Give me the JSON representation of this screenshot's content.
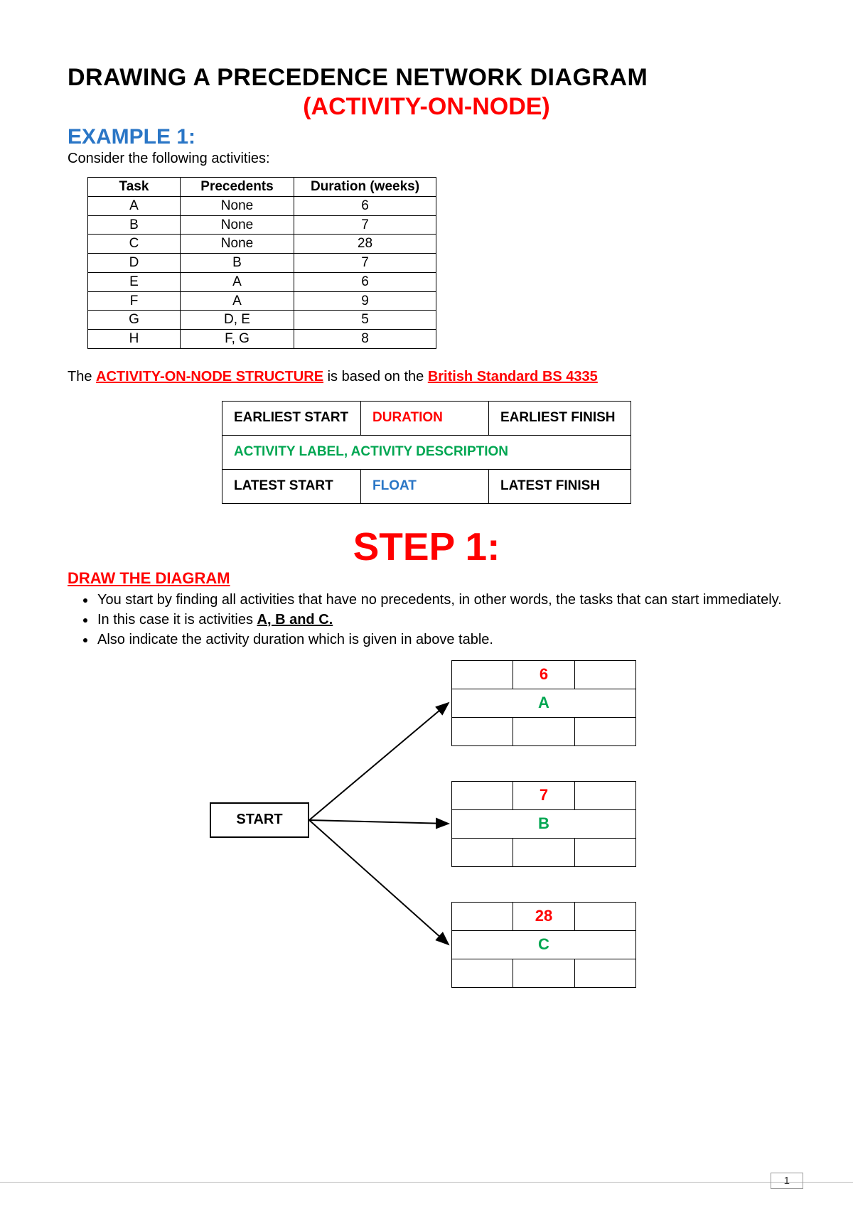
{
  "title_line1": "DRAWING A PRECEDENCE NETWORK DIAGRAM",
  "title_line2": "(ACTIVITY-ON-NODE)",
  "example_label": "EXAMPLE 1:",
  "intro_text": "Consider the following activities:",
  "table": {
    "headers": {
      "task": "Task",
      "precedents": "Precedents",
      "duration": "Duration (weeks)"
    },
    "rows": [
      {
        "task": "A",
        "precedents": "None",
        "duration": "6"
      },
      {
        "task": "B",
        "precedents": "None",
        "duration": "7"
      },
      {
        "task": "C",
        "precedents": "None",
        "duration": "28"
      },
      {
        "task": "D",
        "precedents": "B",
        "duration": "7"
      },
      {
        "task": "E",
        "precedents": "A",
        "duration": "6"
      },
      {
        "task": "F",
        "precedents": "A",
        "duration": "9"
      },
      {
        "task": "G",
        "precedents": "D, E",
        "duration": "5"
      },
      {
        "task": "H",
        "precedents": "F, G",
        "duration": "8"
      }
    ]
  },
  "aon_sentence": {
    "pre": "The ",
    "strong1": "ACTIVITY-ON-NODE STRUCTURE",
    "mid": " is based on the ",
    "strong2": "British Standard BS 4335"
  },
  "node_structure": {
    "earliest_start": "EARLIEST START",
    "duration": "DURATION",
    "earliest_finish": "EARLIEST FINISH",
    "description": "ACTIVITY LABEL, ACTIVITY DESCRIPTION",
    "latest_start": "LATEST START",
    "float": "FLOAT",
    "latest_finish": "LATEST FINISH"
  },
  "step_label": "STEP 1:",
  "draw_heading": "DRAW THE DIAGRAM",
  "bullets": {
    "b1": "You start by finding all activities that have no precedents, in other words, the tasks that can start immediately.",
    "b2_pre": "In this case it is activities ",
    "b2_strong": "A, B and C.",
    "b3": "Also indicate the activity duration which is given in above table."
  },
  "diagram": {
    "start_label": "START",
    "nodes": {
      "A": {
        "duration": "6",
        "label": "A"
      },
      "B": {
        "duration": "7",
        "label": "B"
      },
      "C": {
        "duration": "28",
        "label": "C"
      }
    }
  },
  "page_number": "1"
}
